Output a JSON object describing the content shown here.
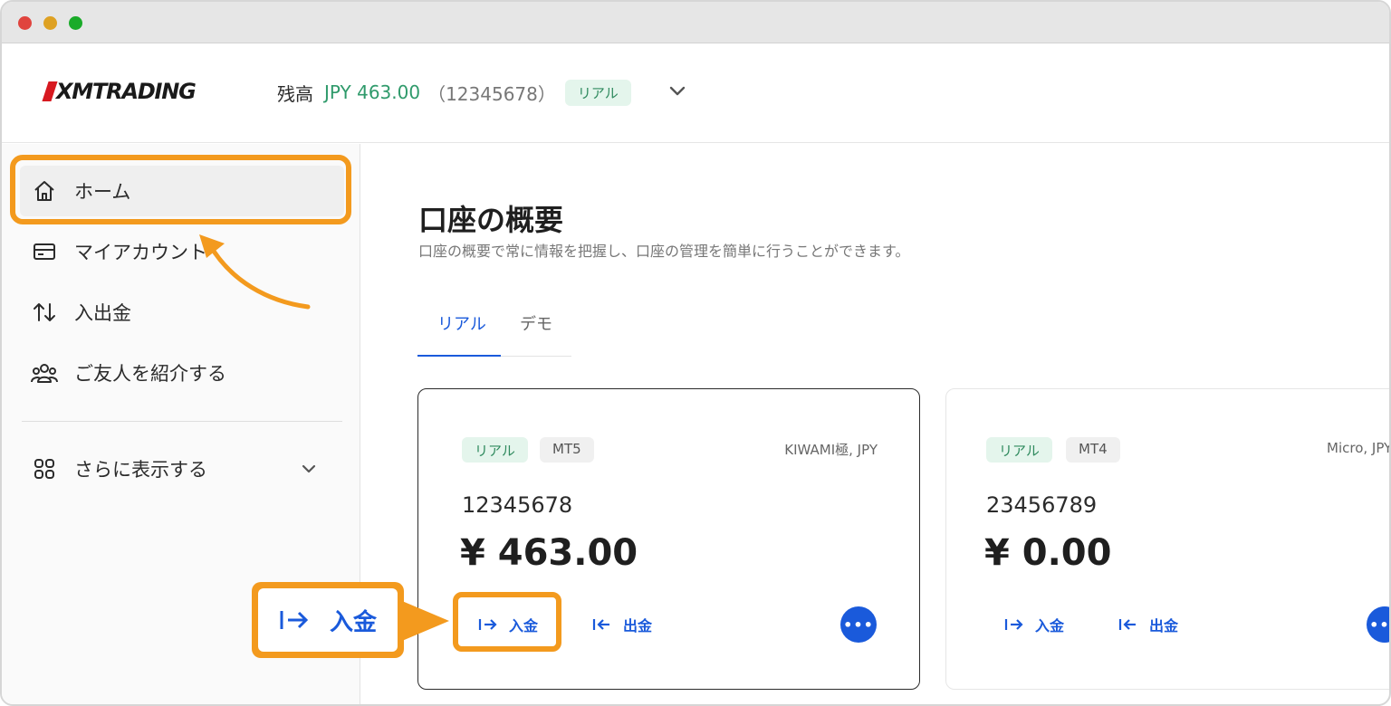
{
  "window": {
    "controls": [
      "close",
      "minimize",
      "maximize"
    ]
  },
  "header": {
    "logo_text": "XMTRADING",
    "balance_label": "残高",
    "balance_amount": "JPY 463.00",
    "account_number": "（12345678）",
    "account_badge": "リアル"
  },
  "sidebar": {
    "items": [
      {
        "label": "ホーム",
        "icon": "home-icon"
      },
      {
        "label": "マイアカウント",
        "icon": "card-icon"
      },
      {
        "label": "入出金",
        "icon": "transfer-icon"
      },
      {
        "label": "ご友人を紹介する",
        "icon": "people-icon"
      }
    ],
    "more_label": "さらに表示する",
    "more_icon": "grid-icon"
  },
  "main": {
    "title": "口座の概要",
    "subtitle": "口座の概要で常に情報を把握し、口座の管理を簡単に行うことができます。",
    "tabs": [
      {
        "label": "リアル",
        "active": true
      },
      {
        "label": "デモ",
        "active": false
      }
    ],
    "accounts": [
      {
        "badge": "リアル",
        "platform": "MT5",
        "type": "KIWAMI極, JPY",
        "number": "12345678",
        "balance": "¥ 463.00",
        "deposit_label": "入金",
        "withdraw_label": "出金",
        "selected": true
      },
      {
        "badge": "リアル",
        "platform": "MT4",
        "type": "Micro, JPY",
        "number": "23456789",
        "balance": "¥ 0.00",
        "deposit_label": "入金",
        "withdraw_label": "出金",
        "selected": false
      }
    ]
  },
  "callout": {
    "label": "入金",
    "icon": "deposit-icon"
  },
  "colors": {
    "accent": "#1a5adb",
    "highlight": "#f39a1e",
    "positive": "#2f9a6b",
    "brand": "#d71920"
  }
}
